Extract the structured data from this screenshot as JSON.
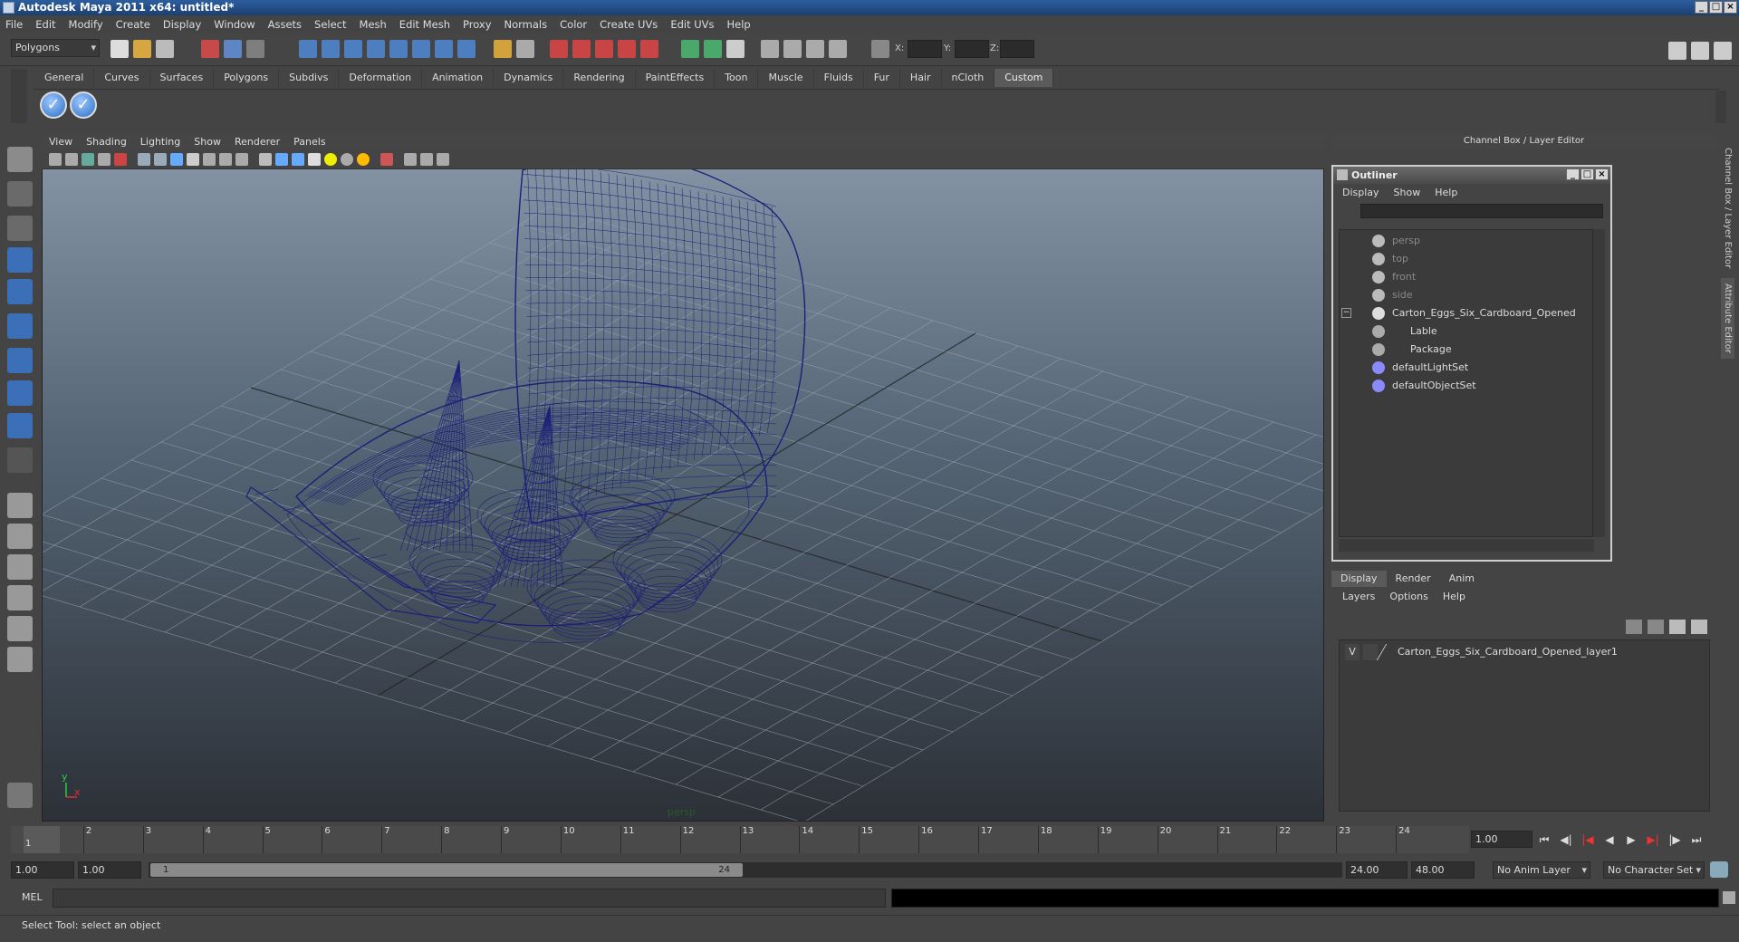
{
  "window": {
    "title": "Autodesk Maya 2011 x64: untitled*"
  },
  "menubar": [
    "File",
    "Edit",
    "Modify",
    "Create",
    "Display",
    "Window",
    "Assets",
    "Select",
    "Mesh",
    "Edit Mesh",
    "Proxy",
    "Normals",
    "Color",
    "Create UVs",
    "Edit UVs",
    "Help"
  ],
  "statusline": {
    "mode": "Polygons",
    "x_label": "X:",
    "y_label": "Y:",
    "z_label": "Z:"
  },
  "shelf": {
    "tabs": [
      "General",
      "Curves",
      "Surfaces",
      "Polygons",
      "Subdivs",
      "Deformation",
      "Animation",
      "Dynamics",
      "Rendering",
      "PaintEffects",
      "Toon",
      "Muscle",
      "Fluids",
      "Fur",
      "Hair",
      "nCloth",
      "Custom"
    ],
    "active_tab": "Custom"
  },
  "viewport": {
    "menus": [
      "View",
      "Shading",
      "Lighting",
      "Show",
      "Renderer",
      "Panels"
    ],
    "camera_label": "persp",
    "axis_y": "y",
    "axis_x": "x",
    "wire_color": "#1c1f78"
  },
  "channelbox": {
    "title": "Channel Box / Layer Editor",
    "side_tab1": "Channel Box / Layer Editor",
    "side_tab2": "Attribute Editor"
  },
  "outliner": {
    "title": "Outliner",
    "menus": [
      "Display",
      "Show",
      "Help"
    ],
    "items": [
      {
        "label": "persp",
        "dim": true,
        "icon": "camera-icon"
      },
      {
        "label": "top",
        "dim": true,
        "icon": "camera-icon"
      },
      {
        "label": "front",
        "dim": true,
        "icon": "camera-icon"
      },
      {
        "label": "side",
        "dim": true,
        "icon": "camera-icon"
      },
      {
        "label": "Carton_Eggs_Six_Cardboard_Opened",
        "dim": false,
        "icon": "group-icon"
      },
      {
        "label": "Lable",
        "dim": false,
        "icon": "mesh-icon"
      },
      {
        "label": "Package",
        "dim": false,
        "icon": "mesh-icon"
      },
      {
        "label": "defaultLightSet",
        "dim": false,
        "icon": "set-icon"
      },
      {
        "label": "defaultObjectSet",
        "dim": false,
        "icon": "set-icon"
      }
    ]
  },
  "layer_editor": {
    "tabs": [
      "Display",
      "Render",
      "Anim"
    ],
    "active_tab": "Display",
    "menus": [
      "Layers",
      "Options",
      "Help"
    ],
    "layer": {
      "visible": "V",
      "name": "Carton_Eggs_Six_Cardboard_Opened_layer1"
    }
  },
  "timeline": {
    "ticks": [
      "1",
      "2",
      "3",
      "4",
      "5",
      "6",
      "7",
      "8",
      "9",
      "10",
      "11",
      "12",
      "13",
      "14",
      "15",
      "16",
      "17",
      "18",
      "19",
      "20",
      "21",
      "22",
      "23",
      "24"
    ],
    "current_frame": "1",
    "current_time": "1.00"
  },
  "range": {
    "start": "1.00",
    "playback_start": "1.00",
    "slider_start": "1",
    "slider_end": "24",
    "playback_end": "24.00",
    "end": "48.00",
    "anim_layer": "No Anim Layer",
    "character_set": "No Character Set"
  },
  "command": {
    "label": "MEL"
  },
  "help": {
    "text": "Select Tool: select an object"
  }
}
